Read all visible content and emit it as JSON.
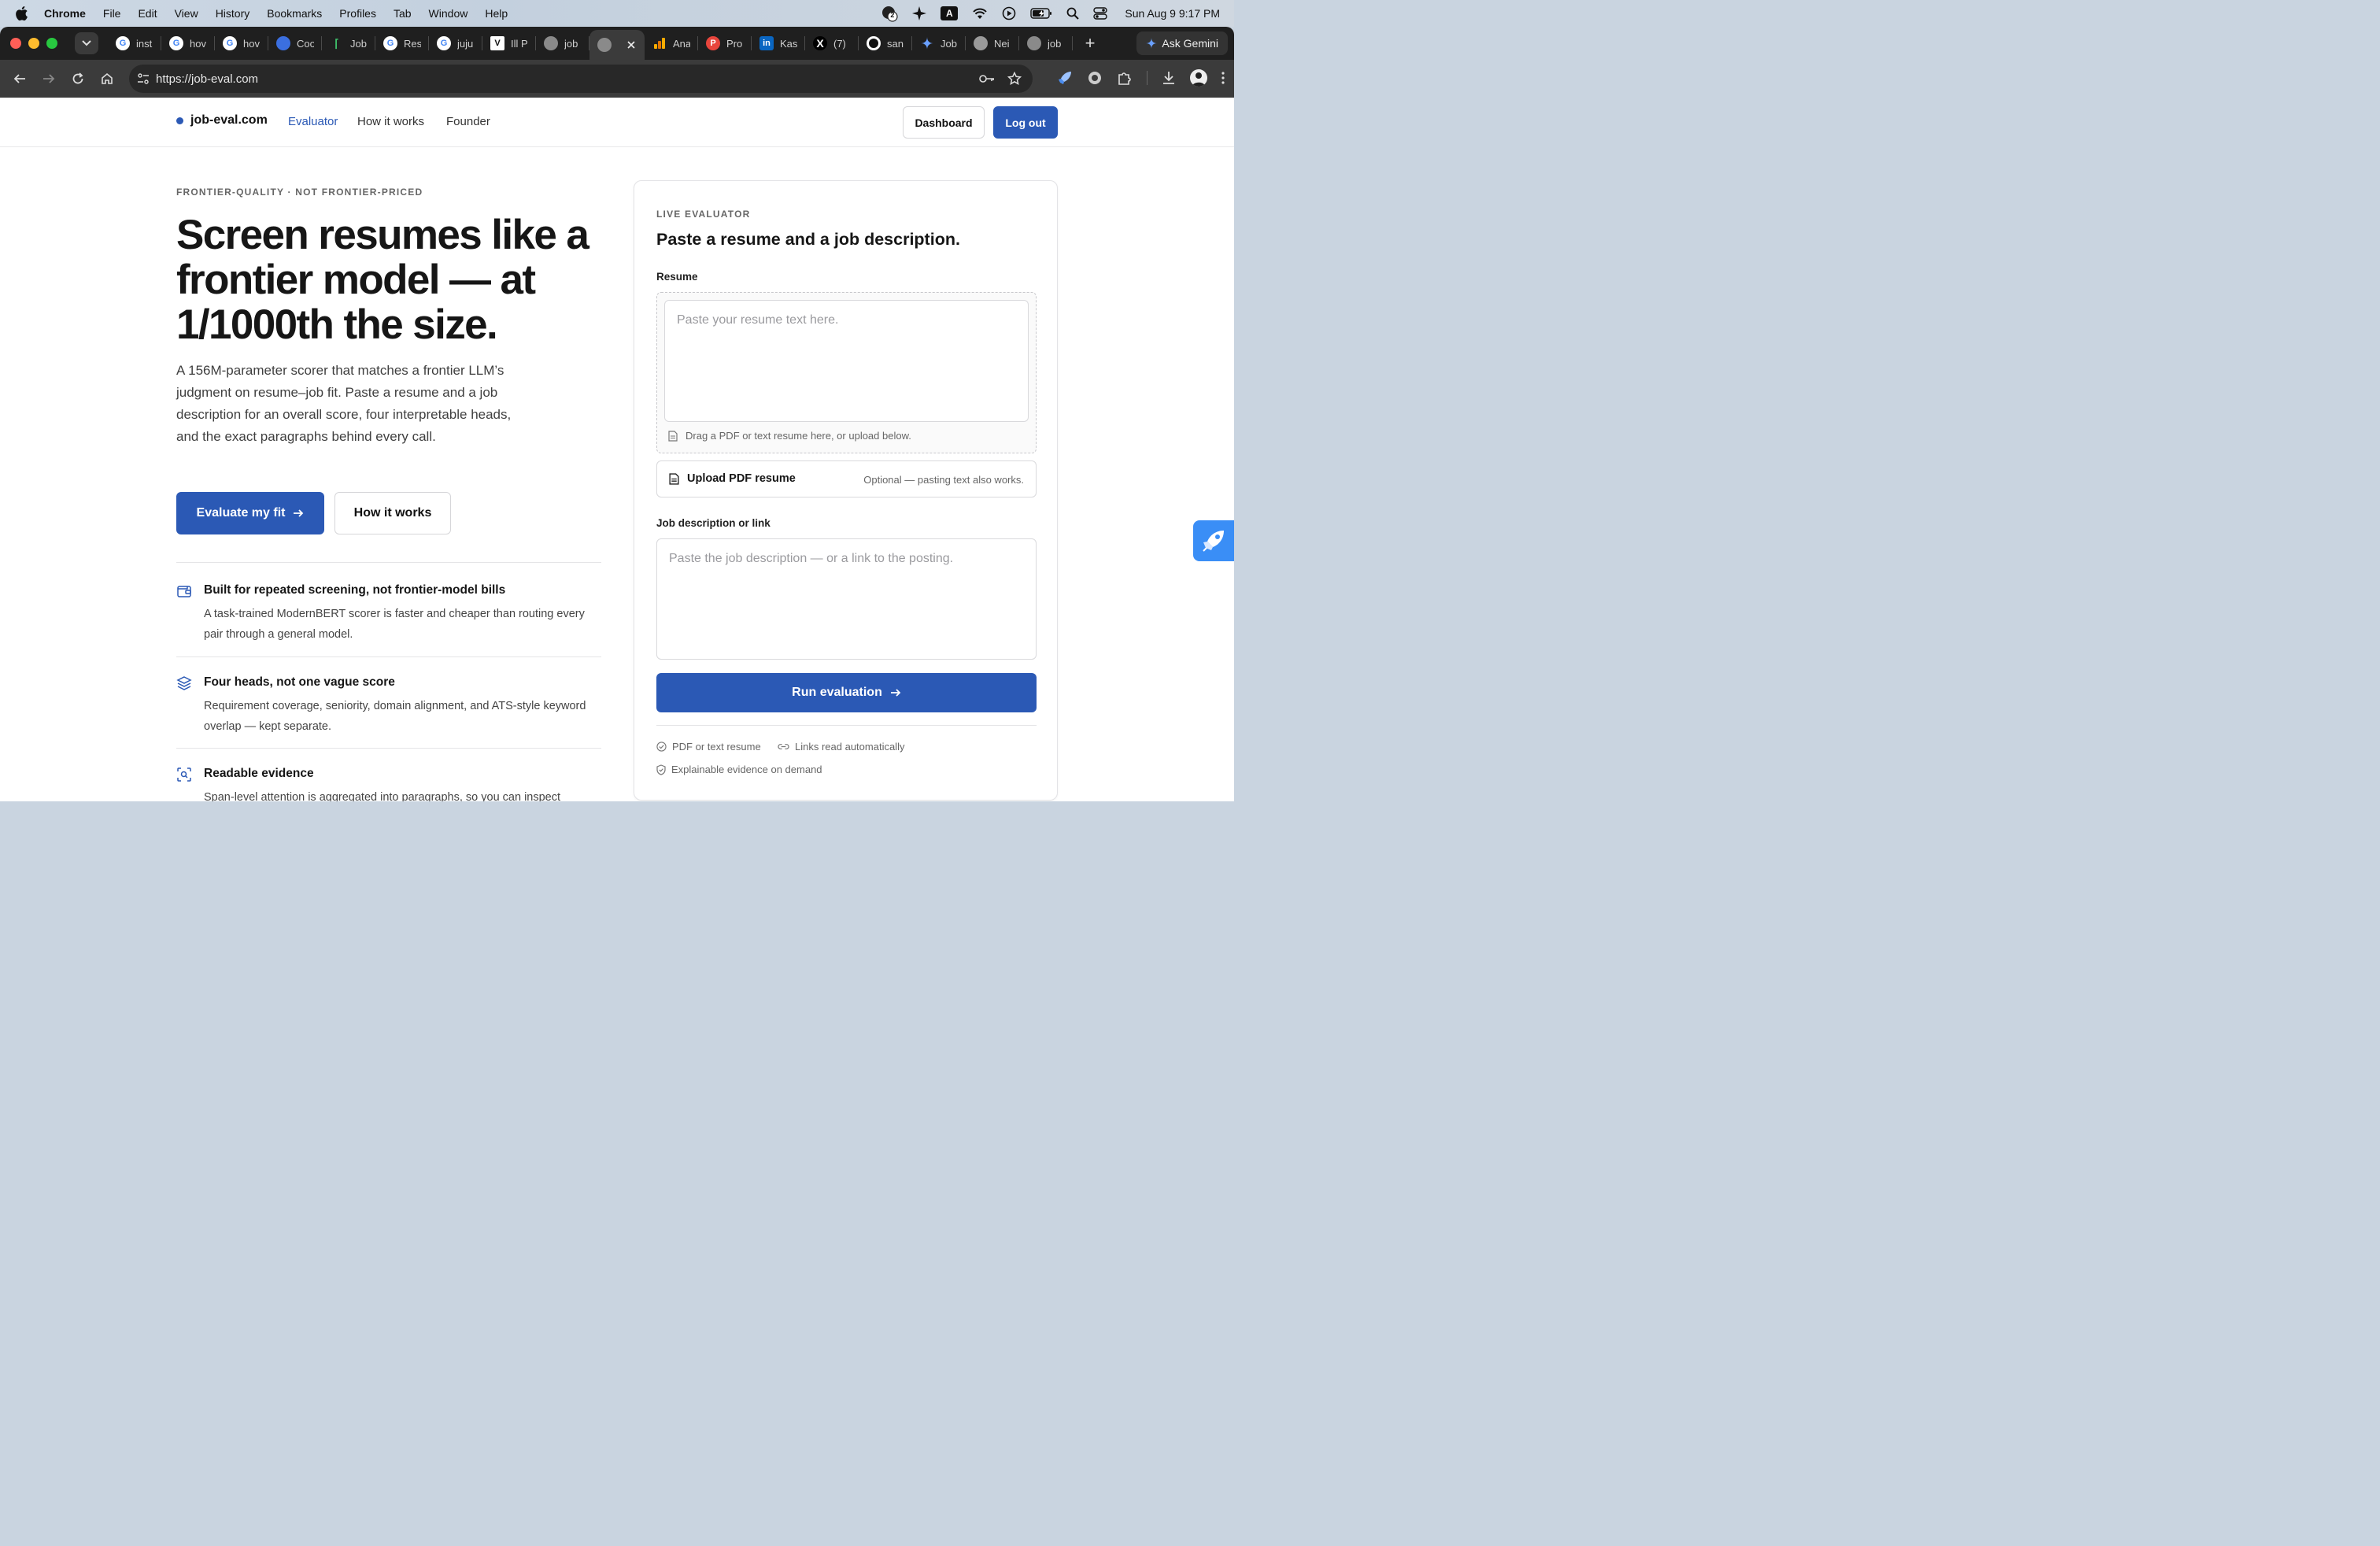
{
  "menubar": {
    "app": "Chrome",
    "items": [
      "File",
      "Edit",
      "View",
      "History",
      "Bookmarks",
      "Profiles",
      "Tab",
      "Window",
      "Help"
    ],
    "badge_count": "2",
    "input_source": "A",
    "clock": "Sun Aug 9  9:17 PM"
  },
  "browser": {
    "tabs": [
      {
        "title": "inst",
        "icon": "google-icon"
      },
      {
        "title": "hov",
        "icon": "google-icon"
      },
      {
        "title": "hov",
        "icon": "google-icon"
      },
      {
        "title": "Coo",
        "icon": "globe-blue-icon"
      },
      {
        "title": "Job",
        "icon": "leaf-icon"
      },
      {
        "title": "Res",
        "icon": "google-icon"
      },
      {
        "title": "juju",
        "icon": "google-icon"
      },
      {
        "title": "Ill P",
        "icon": "v-logo-icon"
      },
      {
        "title": "job",
        "icon": "globe-icon"
      },
      {
        "title": "",
        "icon": "globe-icon",
        "active": true
      },
      {
        "title": "Ana",
        "icon": "analytics-icon"
      },
      {
        "title": "Pro",
        "icon": "p-logo-icon"
      },
      {
        "title": "Kas",
        "icon": "linkedin-icon"
      },
      {
        "title": "(7)",
        "icon": "x-logo-icon"
      },
      {
        "title": "san",
        "icon": "github-icon"
      },
      {
        "title": "Job",
        "icon": "gemini-icon"
      },
      {
        "title": "Nei",
        "icon": "chrome-icon"
      },
      {
        "title": "job",
        "icon": "globe-icon"
      }
    ],
    "gemini_button": "Ask Gemini",
    "url": "https://job-eval.com"
  },
  "site": {
    "brand": "job-eval.com",
    "nav": {
      "evaluator": "Evaluator",
      "how": "How it works",
      "founder": "Founder"
    },
    "dashboard": "Dashboard",
    "logout": "Log out"
  },
  "hero": {
    "eyebrow": "FRONTIER-QUALITY · NOT FRONTIER-PRICED",
    "title": "Screen resumes like a frontier model — at 1/1000th the size.",
    "subtitle": "A 156M-parameter scorer that matches a frontier LLM’s judgment on resume–job fit. Paste a resume and a job description for an overall score, four interpretable heads, and the exact paragraphs behind every call.",
    "cta_primary": "Evaluate my fit",
    "cta_secondary": "How it works"
  },
  "features": [
    {
      "title": "Built for repeated screening, not frontier-model bills",
      "desc": "A task-trained ModernBERT scorer is faster and cheaper than routing every pair through a general model.",
      "icon": "wallet-icon"
    },
    {
      "title": "Four heads, not one vague score",
      "desc": "Requirement coverage, seniority, domain alignment, and ATS-style keyword overlap — kept separate.",
      "icon": "layers-icon"
    },
    {
      "title": "Readable evidence",
      "desc": "Span-level attention is aggregated into paragraphs, so you can inspect",
      "icon": "scan-search-icon"
    }
  ],
  "evaluator": {
    "eyebrow": "LIVE EVALUATOR",
    "title": "Paste a resume and a job description.",
    "resume_label": "Resume",
    "resume_placeholder": "Paste your resume text here.",
    "drop_hint": "Drag a PDF or text resume here, or upload below.",
    "upload_label": "Upload PDF resume",
    "upload_note": "Optional — pasting text also works.",
    "jd_label": "Job description or link",
    "jd_placeholder": "Paste the job description — or a link to the posting.",
    "run_button": "Run evaluation",
    "meta": [
      "PDF or text resume",
      "Links read automatically",
      "Explainable evidence on demand"
    ]
  },
  "colors": {
    "accent": "#2b59b5",
    "tabstrip": "#1f1f1f",
    "toolbar": "#3b3b3b"
  }
}
